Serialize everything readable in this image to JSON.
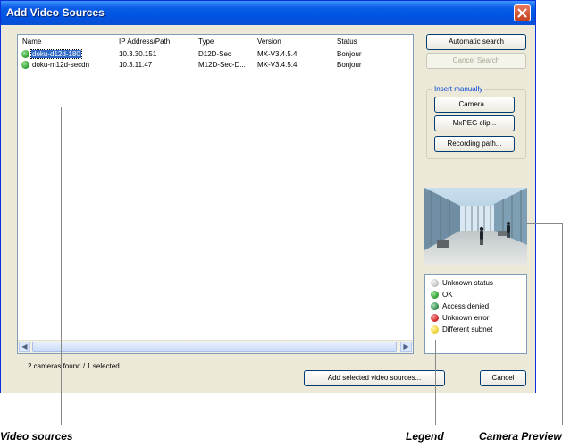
{
  "window": {
    "title": "Add Video Sources"
  },
  "list": {
    "columns": [
      "Name",
      "IP Address/Path",
      "Type",
      "Version",
      "Status"
    ],
    "rows": [
      {
        "name": "doku-d12d-180",
        "ip": "10.3.30.151",
        "type": "D12D-Sec",
        "version": "MX-V3.4.5.4",
        "status": "Bonjour",
        "status_color": "#3aa53a",
        "selected": true
      },
      {
        "name": "doku-m12d-secdn",
        "ip": "10.3.11.47",
        "type": "M12D-Sec-D...",
        "version": "MX-V3.4.5.4",
        "status": "Bonjour",
        "status_color": "#3aa53a",
        "selected": false
      }
    ]
  },
  "buttons": {
    "automatic_search": "Automatic search",
    "cancel_search": "Cancel Search",
    "camera": "Camera...",
    "mxpeg_clip": "MxPEG clip...",
    "recording_path": "Recording path...",
    "add_selected": "Add selected video sources...",
    "cancel": "Cancel"
  },
  "insert_manually": {
    "label": "Insert manually"
  },
  "legend": {
    "items": [
      {
        "label": "Unknown status",
        "color": "#c8c8c8"
      },
      {
        "label": "OK",
        "color": "#3aa53a"
      },
      {
        "label": "Access denied",
        "color": "#3a8f55"
      },
      {
        "label": "Unknown error",
        "color": "#d63030"
      },
      {
        "label": "Different subnet",
        "color": "#f2d43a"
      }
    ]
  },
  "status_text": "2 cameras found / 1 selected",
  "callouts": {
    "video_sources": "Video sources",
    "legend": "Legend",
    "camera_preview": "Camera Preview"
  }
}
